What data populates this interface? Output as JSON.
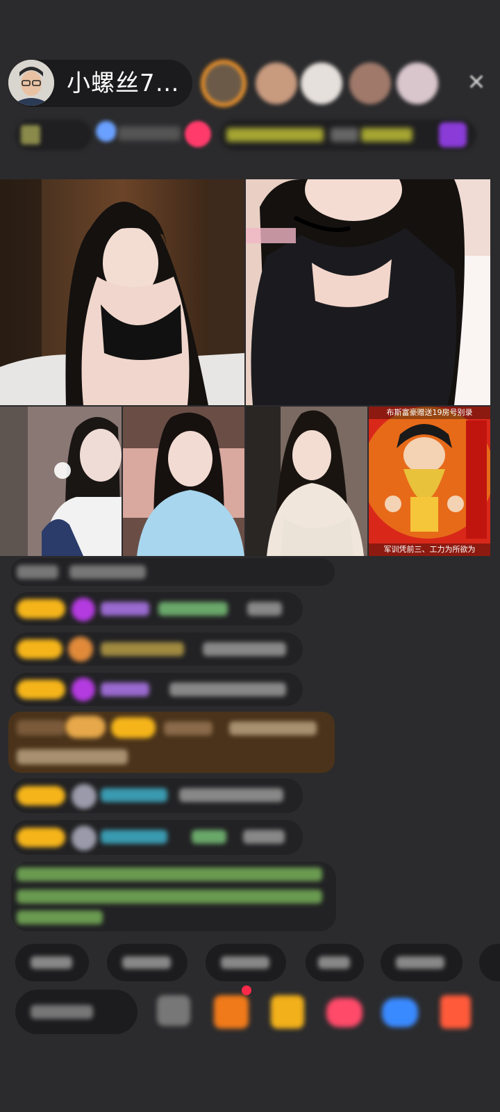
{
  "header": {
    "host_name": "小螺丝7…",
    "close_icon": "close-icon"
  },
  "grid": {
    "tile8_caption_top": "布斯富豪赠送19房号别录",
    "tile8_caption_bottom": "军训凭前三、工力为所欲为"
  },
  "colors": {
    "background": "#2b2b2d",
    "badge_gold": "#f5b51a",
    "chat_bubble": "#222224",
    "highlight_bubble": "#5a3a14"
  }
}
